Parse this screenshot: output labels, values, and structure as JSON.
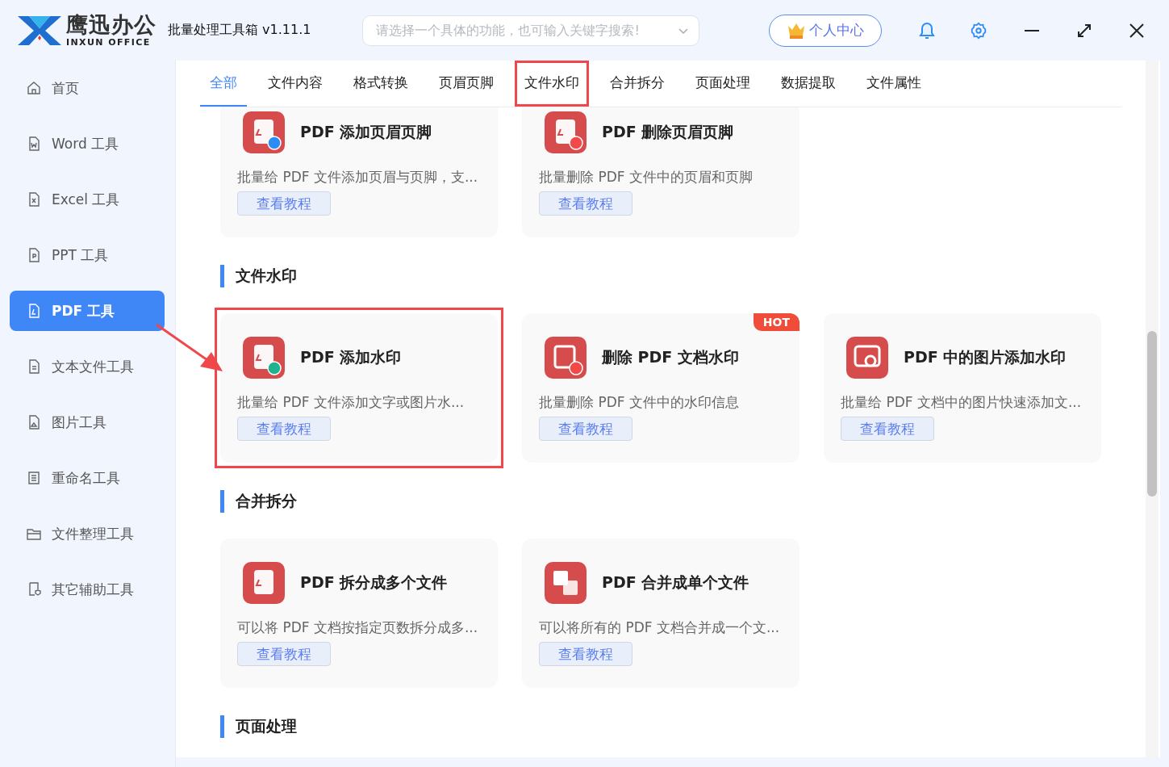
{
  "logo": {
    "name": "鹰迅办公",
    "subtitle": "INXUN OFFICE"
  },
  "window": {
    "title": "批量处理工具箱 v1.11.1"
  },
  "search": {
    "placeholder": "请选择一个具体的功能，也可输入关键字搜索!"
  },
  "user_button": {
    "label": "个人中心"
  },
  "sidebar": {
    "items": [
      {
        "label": "首页",
        "selected": false
      },
      {
        "label": "Word 工具",
        "selected": false
      },
      {
        "label": "Excel 工具",
        "selected": false
      },
      {
        "label": "PPT 工具",
        "selected": false
      },
      {
        "label": "PDF 工具",
        "selected": true
      },
      {
        "label": "文本文件工具",
        "selected": false
      },
      {
        "label": "图片工具",
        "selected": false
      },
      {
        "label": "重命名工具",
        "selected": false
      },
      {
        "label": "文件整理工具",
        "selected": false
      },
      {
        "label": "其它辅助工具",
        "selected": false
      }
    ]
  },
  "tabs": [
    {
      "label": "全部",
      "selected": true,
      "highlighted": false
    },
    {
      "label": "文件内容",
      "selected": false,
      "highlighted": false
    },
    {
      "label": "格式转换",
      "selected": false,
      "highlighted": false
    },
    {
      "label": "页眉页脚",
      "selected": false,
      "highlighted": false
    },
    {
      "label": "文件水印",
      "selected": false,
      "highlighted": true
    },
    {
      "label": "合并拆分",
      "selected": false,
      "highlighted": false
    },
    {
      "label": "页面处理",
      "selected": false,
      "highlighted": false
    },
    {
      "label": "数据提取",
      "selected": false,
      "highlighted": false
    },
    {
      "label": "文件属性",
      "selected": false,
      "highlighted": false
    }
  ],
  "sections": [
    {
      "cards": [
        {
          "title": "PDF 添加页眉页脚",
          "description": "批量给 PDF 文件添加页眉与页脚，支...",
          "button": "查看教程",
          "hot": false,
          "highlighted": false
        },
        {
          "title": "PDF 删除页眉页脚",
          "description": "批量删除 PDF 文件中的页眉和页脚",
          "button": "查看教程",
          "hot": false,
          "highlighted": false
        }
      ]
    },
    {
      "title": "文件水印",
      "cards": [
        {
          "title": "PDF 添加水印",
          "description": "批量给 PDF 文件添加文字或图片水...",
          "button": "查看教程",
          "hot": false,
          "highlighted": true
        },
        {
          "title": "删除 PDF 文档水印",
          "description": "批量删除 PDF 文件中的水印信息",
          "button": "查看教程",
          "hot": true,
          "hot_label": "HOT",
          "highlighted": false
        },
        {
          "title": "PDF 中的图片添加水印",
          "description": "批量给 PDF 文档中的图片快速添加文...",
          "button": "查看教程",
          "hot": false,
          "highlighted": false
        }
      ]
    },
    {
      "title": "合并拆分",
      "cards": [
        {
          "title": "PDF 拆分成多个文件",
          "description": "可以将 PDF 文档按指定页数拆分成多...",
          "button": "查看教程",
          "hot": false,
          "highlighted": false
        },
        {
          "title": "PDF 合并成单个文件",
          "description": "可以将所有的 PDF 文档合并成一个文...",
          "button": "查看教程",
          "hot": false,
          "highlighted": false
        }
      ]
    },
    {
      "title": "页面处理"
    }
  ]
}
